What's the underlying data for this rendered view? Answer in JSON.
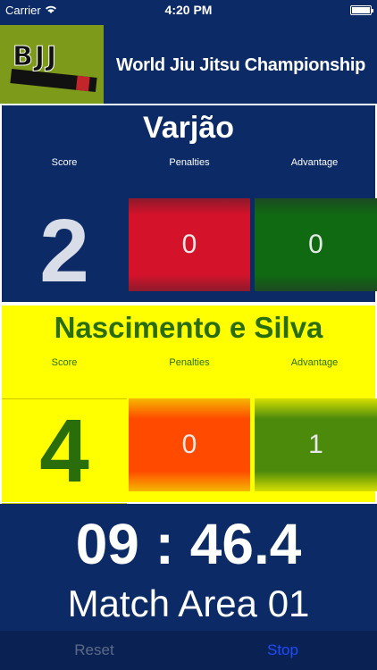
{
  "status_bar": {
    "carrier": "Carrier",
    "time": "4:20 PM"
  },
  "header": {
    "logo_text": "BJJ",
    "title": "World Jiu Jitsu Championship"
  },
  "fighters": [
    {
      "name": "Varjão",
      "labels": {
        "score": "Score",
        "penalties": "Penalties",
        "advantage": "Advantage"
      },
      "score": "2",
      "penalties": "0",
      "advantage": "0"
    },
    {
      "name": "Nascimento e Silva",
      "labels": {
        "score": "Score",
        "penalties": "Penalties",
        "advantage": "Advantage"
      },
      "score": "4",
      "penalties": "0",
      "advantage": "1"
    }
  ],
  "timer": "09 : 46.4",
  "match_area": "Match Area 01",
  "toolbar": {
    "reset_label": "Reset",
    "stop_label": "Stop"
  },
  "colors": {
    "background": "#0b2a66",
    "fighter2_background": "#ffff00",
    "penalty_red": "#d4122a",
    "advantage_green": "#0f6a12",
    "stop_blue": "#1f4bff"
  }
}
